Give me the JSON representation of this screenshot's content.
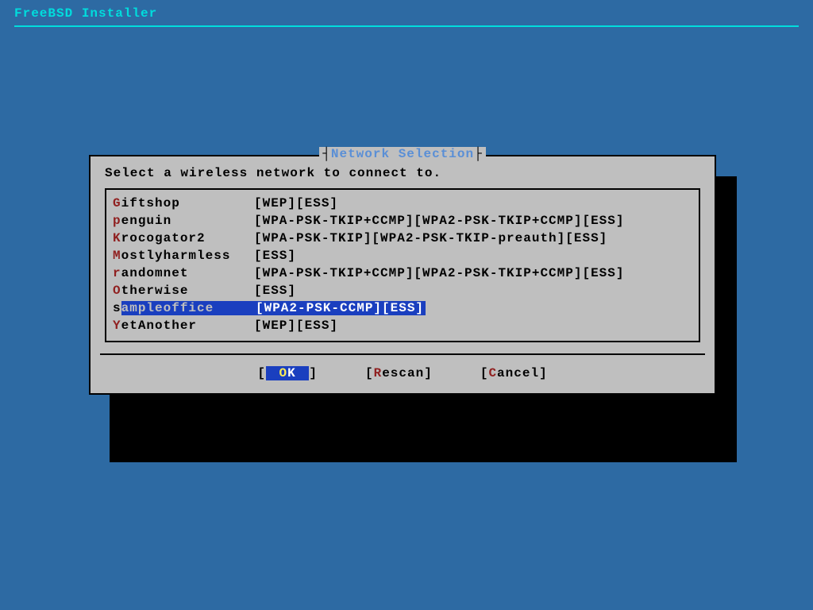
{
  "app_title": "FreeBSD Installer",
  "dialog": {
    "title": "Network Selection",
    "instruction": "Select a wireless network to connect to.",
    "selected_index": 6,
    "networks": [
      {
        "hotkey": "G",
        "rest": "iftshop",
        "caps": "[WEP][ESS]"
      },
      {
        "hotkey": "p",
        "rest": "enguin",
        "caps": "[WPA-PSK-TKIP+CCMP][WPA2-PSK-TKIP+CCMP][ESS]"
      },
      {
        "hotkey": "K",
        "rest": "rocogator2",
        "caps": "[WPA-PSK-TKIP][WPA2-PSK-TKIP-preauth][ESS]"
      },
      {
        "hotkey": "M",
        "rest": "ostlyharmless",
        "caps": "[ESS]"
      },
      {
        "hotkey": "r",
        "rest": "andomnet",
        "caps": "[WPA-PSK-TKIP+CCMP][WPA2-PSK-TKIP+CCMP][ESS]"
      },
      {
        "hotkey": "O",
        "rest": "therwise",
        "caps": "[ESS]"
      },
      {
        "hotkey": "s",
        "rest": "ampleoffice",
        "caps": "[WPA2-PSK-CCMP][ESS]"
      },
      {
        "hotkey": "Y",
        "rest": "etAnother",
        "caps": "[WEP][ESS]"
      }
    ],
    "buttons": {
      "ok": {
        "label": "OK",
        "hot": "O",
        "rest": "K"
      },
      "rescan": {
        "label": "Rescan",
        "hot": "R",
        "rest": "escan"
      },
      "cancel": {
        "label": "Cancel",
        "hot": "C",
        "rest": "ancel"
      },
      "active_index": 0
    }
  }
}
